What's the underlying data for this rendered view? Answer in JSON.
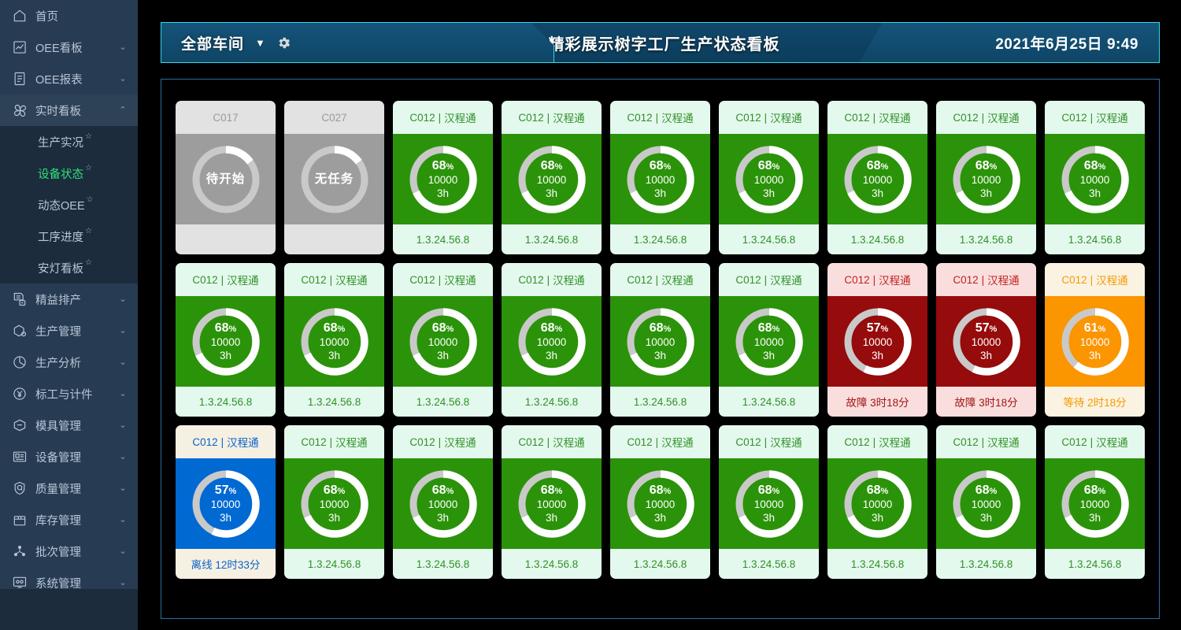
{
  "sidebar": {
    "items": [
      {
        "label": "首页",
        "icon": "home-icon",
        "caret": "",
        "expanded": false
      },
      {
        "label": "OEE看板",
        "icon": "chart-line-icon",
        "caret": "⌄",
        "expanded": false
      },
      {
        "label": "OEE报表",
        "icon": "report-icon",
        "caret": "⌄",
        "expanded": false
      },
      {
        "label": "实时看板",
        "icon": "realtime-icon",
        "caret": "⌃",
        "expanded": true
      },
      {
        "label": "精益排产",
        "icon": "schedule-icon",
        "caret": "⌄",
        "expanded": false
      },
      {
        "label": "生产管理",
        "icon": "box-gear-icon",
        "caret": "⌄",
        "expanded": false
      },
      {
        "label": "生产分析",
        "icon": "pie-chart-icon",
        "caret": "⌄",
        "expanded": false
      },
      {
        "label": "标工与计件",
        "icon": "yuan-coin-icon",
        "caret": "⌄",
        "expanded": false
      },
      {
        "label": "模具管理",
        "icon": "mold-icon",
        "caret": "⌄",
        "expanded": false
      },
      {
        "label": "设备管理",
        "icon": "machine-icon",
        "caret": "⌄",
        "expanded": false
      },
      {
        "label": "质量管理",
        "icon": "shield-q-icon",
        "caret": "⌄",
        "expanded": false
      },
      {
        "label": "库存管理",
        "icon": "inventory-box-icon",
        "caret": "⌄",
        "expanded": false
      },
      {
        "label": "批次管理",
        "icon": "batch-nodes-icon",
        "caret": "⌄",
        "expanded": false
      },
      {
        "label": "系统管理",
        "icon": "monitor-gear-icon",
        "caret": "⌄",
        "expanded": false
      }
    ],
    "submenu": [
      {
        "label": "生产实况",
        "star": "☆",
        "active": false
      },
      {
        "label": "设备状态",
        "star": "☆",
        "active": true
      },
      {
        "label": "动态OEE",
        "star": "☆",
        "active": false
      },
      {
        "label": "工序进度",
        "star": "☆",
        "active": false
      },
      {
        "label": "安灯看板",
        "star": "☆",
        "active": false
      }
    ],
    "active_color": "#2ee07a"
  },
  "header": {
    "workshop": "全部车间",
    "workshop_caret": "▼",
    "gear_icon": "gear-icon",
    "title": "精彩展示树字工厂生产状态看板",
    "datetime": "2021年6月25日 9:49",
    "accent_color": "#35d7ec"
  },
  "cards": [
    {
      "code": "C017",
      "name": "",
      "theme": "gray",
      "state_text": "待开始",
      "percent": 15,
      "qty": "",
      "duration": "",
      "footer": ""
    },
    {
      "code": "C027",
      "name": "",
      "theme": "gray",
      "state_text": "无任务",
      "percent": 15,
      "qty": "",
      "duration": "",
      "footer": ""
    },
    {
      "code": "C012",
      "name": "汉程通",
      "theme": "green",
      "state_text": "",
      "percent": 68,
      "qty": "10000",
      "duration": "3h",
      "footer": "1.3.24.56.8"
    },
    {
      "code": "C012",
      "name": "汉程通",
      "theme": "green",
      "state_text": "",
      "percent": 68,
      "qty": "10000",
      "duration": "3h",
      "footer": "1.3.24.56.8"
    },
    {
      "code": "C012",
      "name": "汉程通",
      "theme": "green",
      "state_text": "",
      "percent": 68,
      "qty": "10000",
      "duration": "3h",
      "footer": "1.3.24.56.8"
    },
    {
      "code": "C012",
      "name": "汉程通",
      "theme": "green",
      "state_text": "",
      "percent": 68,
      "qty": "10000",
      "duration": "3h",
      "footer": "1.3.24.56.8"
    },
    {
      "code": "C012",
      "name": "汉程通",
      "theme": "green",
      "state_text": "",
      "percent": 68,
      "qty": "10000",
      "duration": "3h",
      "footer": "1.3.24.56.8"
    },
    {
      "code": "C012",
      "name": "汉程通",
      "theme": "green",
      "state_text": "",
      "percent": 68,
      "qty": "10000",
      "duration": "3h",
      "footer": "1.3.24.56.8"
    },
    {
      "code": "C012",
      "name": "汉程通",
      "theme": "green",
      "state_text": "",
      "percent": 68,
      "qty": "10000",
      "duration": "3h",
      "footer": "1.3.24.56.8"
    },
    {
      "code": "C012",
      "name": "汉程通",
      "theme": "green",
      "state_text": "",
      "percent": 68,
      "qty": "10000",
      "duration": "3h",
      "footer": "1.3.24.56.8"
    },
    {
      "code": "C012",
      "name": "汉程通",
      "theme": "green",
      "state_text": "",
      "percent": 68,
      "qty": "10000",
      "duration": "3h",
      "footer": "1.3.24.56.8"
    },
    {
      "code": "C012",
      "name": "汉程通",
      "theme": "green",
      "state_text": "",
      "percent": 68,
      "qty": "10000",
      "duration": "3h",
      "footer": "1.3.24.56.8"
    },
    {
      "code": "C012",
      "name": "汉程通",
      "theme": "green",
      "state_text": "",
      "percent": 68,
      "qty": "10000",
      "duration": "3h",
      "footer": "1.3.24.56.8"
    },
    {
      "code": "C012",
      "name": "汉程通",
      "theme": "green",
      "state_text": "",
      "percent": 68,
      "qty": "10000",
      "duration": "3h",
      "footer": "1.3.24.56.8"
    },
    {
      "code": "C012",
      "name": "汉程通",
      "theme": "green",
      "state_text": "",
      "percent": 68,
      "qty": "10000",
      "duration": "3h",
      "footer": "1.3.24.56.8"
    },
    {
      "code": "C012",
      "name": "汉程通",
      "theme": "red",
      "state_text": "",
      "percent": 57,
      "qty": "10000",
      "duration": "3h",
      "footer": "故障 3时18分"
    },
    {
      "code": "C012",
      "name": "汉程通",
      "theme": "red",
      "state_text": "",
      "percent": 57,
      "qty": "10000",
      "duration": "3h",
      "footer": "故障 3时18分"
    },
    {
      "code": "C012",
      "name": "汉程通",
      "theme": "orange",
      "state_text": "",
      "percent": 61,
      "qty": "10000",
      "duration": "3h",
      "footer": "等待 2时18分"
    },
    {
      "code": "C012",
      "name": "汉程通",
      "theme": "blue",
      "state_text": "",
      "percent": 57,
      "qty": "10000",
      "duration": "3h",
      "footer": "离线 12时33分"
    },
    {
      "code": "C012",
      "name": "汉程通",
      "theme": "green",
      "state_text": "",
      "percent": 68,
      "qty": "10000",
      "duration": "3h",
      "footer": "1.3.24.56.8"
    },
    {
      "code": "C012",
      "name": "汉程通",
      "theme": "green",
      "state_text": "",
      "percent": 68,
      "qty": "10000",
      "duration": "3h",
      "footer": "1.3.24.56.8"
    },
    {
      "code": "C012",
      "name": "汉程通",
      "theme": "green",
      "state_text": "",
      "percent": 68,
      "qty": "10000",
      "duration": "3h",
      "footer": "1.3.24.56.8"
    },
    {
      "code": "C012",
      "name": "汉程通",
      "theme": "green",
      "state_text": "",
      "percent": 68,
      "qty": "10000",
      "duration": "3h",
      "footer": "1.3.24.56.8"
    },
    {
      "code": "C012",
      "name": "汉程通",
      "theme": "green",
      "state_text": "",
      "percent": 68,
      "qty": "10000",
      "duration": "3h",
      "footer": "1.3.24.56.8"
    },
    {
      "code": "C012",
      "name": "汉程通",
      "theme": "green",
      "state_text": "",
      "percent": 68,
      "qty": "10000",
      "duration": "3h",
      "footer": "1.3.24.56.8"
    },
    {
      "code": "C012",
      "name": "汉程通",
      "theme": "green",
      "state_text": "",
      "percent": 68,
      "qty": "10000",
      "duration": "3h",
      "footer": "1.3.24.56.8"
    },
    {
      "code": "C012",
      "name": "汉程通",
      "theme": "green",
      "state_text": "",
      "percent": 68,
      "qty": "10000",
      "duration": "3h",
      "footer": "1.3.24.56.8"
    }
  ],
  "legend": {
    "percent_unit": "%",
    "separator": "|"
  }
}
